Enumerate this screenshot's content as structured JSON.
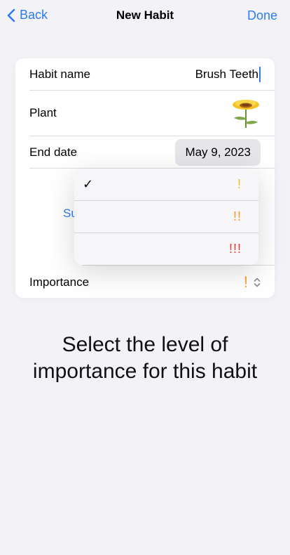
{
  "nav": {
    "back_label": "Back",
    "title": "New Habit",
    "done_label": "Done"
  },
  "form": {
    "habit_name_label": "Habit name",
    "habit_name_value": "Brush Teeth",
    "plant_label": "Plant",
    "plant_icon": "sunflower-icon",
    "end_date_label": "End date",
    "end_date_value": "May 9, 2023",
    "partial_hidden_label": "Su",
    "importance_label": "Importance",
    "importance_value": "!"
  },
  "dropdown": {
    "items": [
      {
        "checked": true,
        "checkmark": "✓",
        "label": "!",
        "color": "#f7b92b"
      },
      {
        "checked": false,
        "label": "!!",
        "color": "#f29a22"
      },
      {
        "checked": false,
        "label": "!!!",
        "color": "#e63a2d"
      }
    ]
  },
  "instruction": {
    "line1": "Select the level of",
    "line2": "importance for this habit"
  },
  "colors": {
    "accent": "#2f7bf6",
    "background": "#f2f2f7"
  }
}
